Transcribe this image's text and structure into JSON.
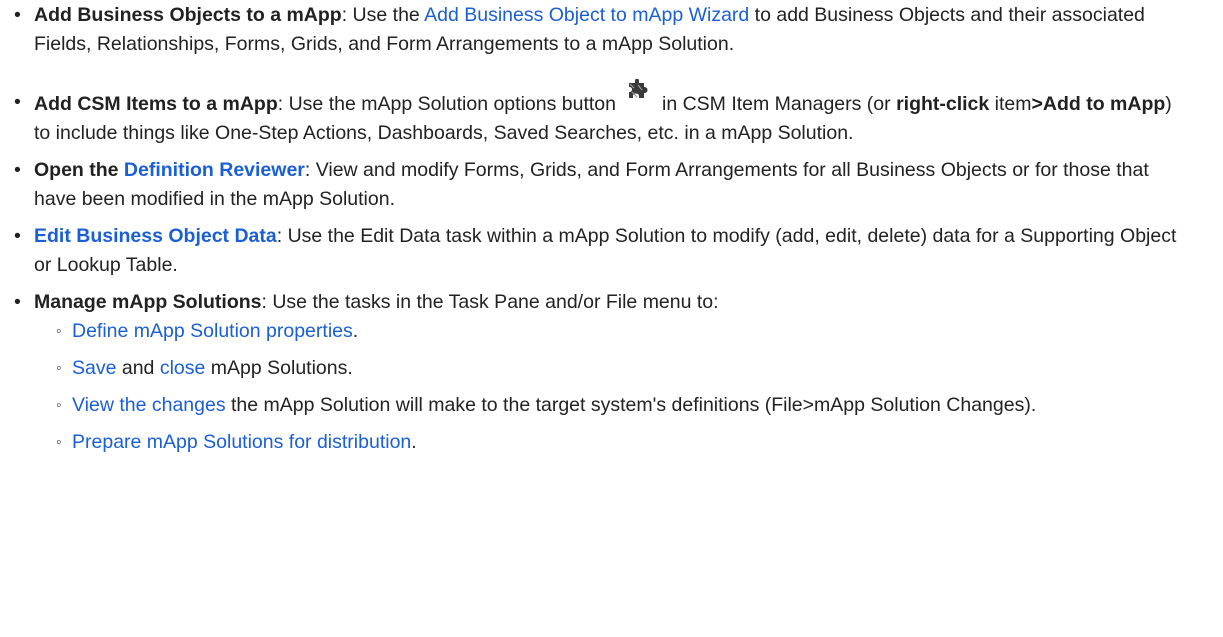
{
  "items": [
    {
      "title": "Add Business Objects to a mApp",
      "pre": ": Use the ",
      "link": "Add Business Object to mApp Wizard",
      "post": " to add Business Objects and their associated Fields, Relationships, Forms, Grids, and Form Arrangements to a mApp Solution."
    },
    {
      "title": "Add CSM Items to a mApp",
      "pre": ": Use the mApp Solution options button",
      "icon": "puzzle-piece-icon",
      "mid": "in CSM Item Managers (or ",
      "bold_a": "right-click",
      "mid2": " item",
      "bold_b": ">Add to mApp",
      "post": ") to include things like One-Step Actions, Dashboards, Saved Searches, etc. in a mApp Solution."
    },
    {
      "title": "Open the ",
      "link": "Definition Reviewer",
      "post": ": View and modify Forms, Grids, and Form Arrangements for all Business Objects or for those that have been modified in the mApp Solution."
    },
    {
      "link": "Edit Business Object Data",
      "post": ": Use the Edit Data task within a mApp Solution to modify (add, edit, delete) data for a Supporting Object or Lookup Table."
    },
    {
      "title": "Manage mApp Solutions",
      "post": ": Use the tasks in the Task Pane and/or File menu to:",
      "subitems": [
        {
          "link": "Define mApp Solution properties",
          "post": "."
        },
        {
          "link1": "Save",
          "mid": " and ",
          "link2": "close",
          "post": " mApp Solutions."
        },
        {
          "link": "View the changes",
          "post": " the mApp Solution will make to the target system's definitions (File>mApp Solution Changes)."
        },
        {
          "link": "Prepare mApp Solutions for distribution",
          "post": "."
        }
      ]
    }
  ],
  "colors": {
    "link": "#1a5fd6",
    "text": "#222222",
    "icon": "#3a3a3a"
  }
}
